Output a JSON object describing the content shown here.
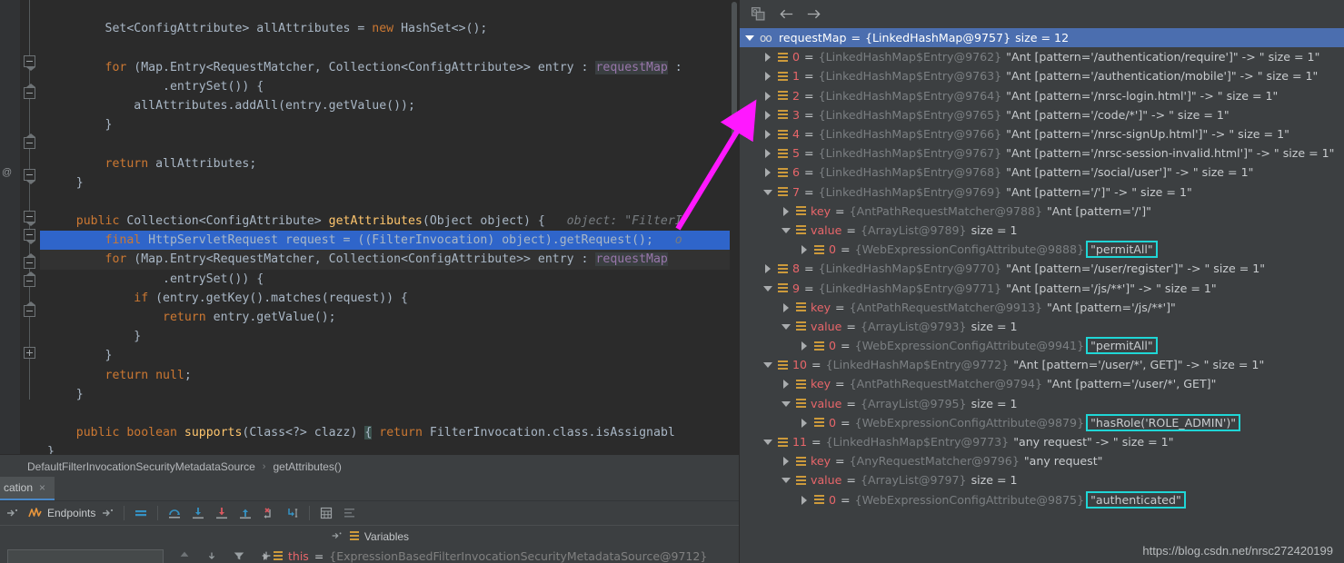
{
  "editor": {
    "lines": [
      {
        "indent": 0,
        "tokens": []
      },
      {
        "indent": 0,
        "tokens": [
          {
            "t": "        ",
            "c": "pa"
          },
          {
            "t": "Set<ConfigAttribute> allAttributes = ",
            "c": "pa"
          },
          {
            "t": "new ",
            "c": "k"
          },
          {
            "t": "HashSet<>();",
            "c": "pa"
          }
        ]
      },
      {
        "indent": 0,
        "tokens": []
      },
      {
        "indent": 0,
        "tokens": [
          {
            "t": "        ",
            "c": "pa"
          },
          {
            "t": "for ",
            "c": "k"
          },
          {
            "t": "(Map.Entry<RequestMatcher, Collection<ConfigAttribute>> entry : ",
            "c": "pa"
          },
          {
            "t": "requestMap",
            "c": "hl-field"
          },
          {
            "t": " :",
            "c": "pa"
          }
        ]
      },
      {
        "indent": 0,
        "tokens": [
          {
            "t": "                .entrySet()) {",
            "c": "pa"
          }
        ]
      },
      {
        "indent": 0,
        "tokens": [
          {
            "t": "            allAttributes.addAll(entry.getValue());",
            "c": "pa"
          }
        ]
      },
      {
        "indent": 0,
        "tokens": [
          {
            "t": "        }",
            "c": "pa"
          }
        ]
      },
      {
        "indent": 0,
        "tokens": []
      },
      {
        "indent": 0,
        "tokens": [
          {
            "t": "        ",
            "c": "pa"
          },
          {
            "t": "return ",
            "c": "k"
          },
          {
            "t": "allAttributes;",
            "c": "pa"
          }
        ]
      },
      {
        "indent": 0,
        "tokens": [
          {
            "t": "    }",
            "c": "pa"
          }
        ]
      },
      {
        "indent": 0,
        "tokens": []
      },
      {
        "indent": 0,
        "tokens": [
          {
            "t": "    ",
            "c": "pa"
          },
          {
            "t": "public ",
            "c": "k"
          },
          {
            "t": "Collection<ConfigAttribute> ",
            "c": "pa"
          },
          {
            "t": "getAttributes",
            "c": "fn"
          },
          {
            "t": "(Object object) {",
            "c": "pa"
          },
          {
            "t": "   object: ",
            "c": "hint"
          },
          {
            "t": "\"FilterI",
            "c": "hint"
          }
        ]
      },
      {
        "indent": 0,
        "selected": true,
        "tokens": [
          {
            "t": "        ",
            "c": "pa"
          },
          {
            "t": "final ",
            "c": "k"
          },
          {
            "t": "HttpServletRequest request = ((FilterInvocation) object).getRequest();",
            "c": "pa"
          },
          {
            "t": "   o",
            "c": "hint"
          }
        ]
      },
      {
        "indent": 0,
        "current": true,
        "tokens": [
          {
            "t": "        ",
            "c": "pa"
          },
          {
            "t": "for ",
            "c": "k"
          },
          {
            "t": "(Map.Entry<RequestMatcher, Collection<ConfigAttribute>> entry : ",
            "c": "pa"
          },
          {
            "t": "requestMap",
            "c": "hl-field"
          }
        ]
      },
      {
        "indent": 0,
        "tokens": [
          {
            "t": "                .entrySet()) {",
            "c": "pa"
          }
        ]
      },
      {
        "indent": 0,
        "tokens": [
          {
            "t": "            ",
            "c": "pa"
          },
          {
            "t": "if ",
            "c": "k"
          },
          {
            "t": "(entry.getKey().matches(request)) {",
            "c": "pa"
          }
        ]
      },
      {
        "indent": 0,
        "tokens": [
          {
            "t": "                ",
            "c": "pa"
          },
          {
            "t": "return ",
            "c": "k"
          },
          {
            "t": "entry.getValue();",
            "c": "pa"
          }
        ]
      },
      {
        "indent": 0,
        "tokens": [
          {
            "t": "            }",
            "c": "pa"
          }
        ]
      },
      {
        "indent": 0,
        "tokens": [
          {
            "t": "        }",
            "c": "pa"
          }
        ]
      },
      {
        "indent": 0,
        "tokens": [
          {
            "t": "        ",
            "c": "pa"
          },
          {
            "t": "return ",
            "c": "k"
          },
          {
            "t": "null",
            "c": "k"
          },
          {
            "t": ";",
            "c": "pa"
          }
        ]
      },
      {
        "indent": 0,
        "tokens": [
          {
            "t": "    }",
            "c": "pa"
          }
        ]
      },
      {
        "indent": 0,
        "tokens": []
      },
      {
        "indent": 0,
        "tokens": [
          {
            "t": "    ",
            "c": "pa"
          },
          {
            "t": "public ",
            "c": "k"
          },
          {
            "t": "boolean ",
            "c": "k"
          },
          {
            "t": "supports",
            "c": "fn"
          },
          {
            "t": "(Class<?> clazz) ",
            "c": "pa"
          },
          {
            "t": "{",
            "c": "brace-hl"
          },
          {
            "t": " ",
            "c": "pa"
          },
          {
            "t": "return ",
            "c": "k"
          },
          {
            "t": "FilterInvocation.class.isAssignabl",
            "c": "pa"
          }
        ]
      },
      {
        "indent": 0,
        "tokens": [
          {
            "t": "}",
            "c": "pa"
          }
        ]
      }
    ]
  },
  "breadcrumb": {
    "class_name": "DefaultFilterInvocationSecurityMetadataSource",
    "separator": "›",
    "method_name": "getAttributes()"
  },
  "tool_window": {
    "tab_label": "cation",
    "close_glyph": "×"
  },
  "debug_toolbar": {
    "endpoints_label": "Endpoints",
    "icons": [
      "mute-breakpoints-icon",
      "step-over-icon",
      "step-into-icon",
      "force-step-into-icon",
      "step-out-icon",
      "drop-frame-icon",
      "run-to-cursor-icon",
      "evaluate-expression-icon",
      "settings-icon"
    ]
  },
  "variables_panel": {
    "header_label": "Variables",
    "row": {
      "name": "this",
      "equals": "=",
      "type": "{ExpressionBasedFilterInvocationSecurityMetadataSource@9712}"
    }
  },
  "inspect": {
    "toolbar_icons": [
      "copy-value-icon",
      "back-arrow-icon",
      "forward-arrow-icon"
    ],
    "root": {
      "twist": "open",
      "icon": "chain-icon",
      "icon_glyph": "oo",
      "name": "requestMap",
      "equals": "=",
      "type": "{LinkedHashMap@9757}",
      "value": "size = 12",
      "selected": true
    },
    "rows": [
      {
        "depth": 1,
        "twist": "closed",
        "idx": "0",
        "equals": "=",
        "type": "{LinkedHashMap$Entry@9762}",
        "value": "\"Ant [pattern='/authentication/require']\" -> \" size = 1\""
      },
      {
        "depth": 1,
        "twist": "closed",
        "idx": "1",
        "equals": "=",
        "type": "{LinkedHashMap$Entry@9763}",
        "value": "\"Ant [pattern='/authentication/mobile']\" -> \" size = 1\""
      },
      {
        "depth": 1,
        "twist": "closed",
        "idx": "2",
        "equals": "=",
        "type": "{LinkedHashMap$Entry@9764}",
        "value": "\"Ant [pattern='/nrsc-login.html']\" -> \" size = 1\""
      },
      {
        "depth": 1,
        "twist": "closed",
        "idx": "3",
        "equals": "=",
        "type": "{LinkedHashMap$Entry@9765}",
        "value": "\"Ant [pattern='/code/*']\" -> \" size = 1\""
      },
      {
        "depth": 1,
        "twist": "closed",
        "idx": "4",
        "equals": "=",
        "type": "{LinkedHashMap$Entry@9766}",
        "value": "\"Ant [pattern='/nrsc-signUp.html']\" -> \" size = 1\""
      },
      {
        "depth": 1,
        "twist": "closed",
        "idx": "5",
        "equals": "=",
        "type": "{LinkedHashMap$Entry@9767}",
        "value": "\"Ant [pattern='/nrsc-session-invalid.html']\" -> \" size = 1\""
      },
      {
        "depth": 1,
        "twist": "closed",
        "idx": "6",
        "equals": "=",
        "type": "{LinkedHashMap$Entry@9768}",
        "value": "\"Ant [pattern='/social/user']\" -> \" size = 1\""
      },
      {
        "depth": 1,
        "twist": "open",
        "idx": "7",
        "equals": "=",
        "type": "{LinkedHashMap$Entry@9769}",
        "value": "\"Ant [pattern='/']\" -> \" size = 1\""
      },
      {
        "depth": 2,
        "twist": "closed",
        "idx": "key",
        "equals": "=",
        "type": "{AntPathRequestMatcher@9788}",
        "value": "\"Ant [pattern='/']\""
      },
      {
        "depth": 2,
        "twist": "open",
        "idx": "value",
        "equals": "=",
        "type": "{ArrayList@9789}",
        "value": "size = 1"
      },
      {
        "depth": 3,
        "twist": "closed",
        "idx": "0",
        "equals": "=",
        "type": "{WebExpressionConfigAttribute@9888}",
        "value": "\"permitAll\"",
        "boxed": true
      },
      {
        "depth": 1,
        "twist": "closed",
        "idx": "8",
        "equals": "=",
        "type": "{LinkedHashMap$Entry@9770}",
        "value": "\"Ant [pattern='/user/register']\" -> \" size = 1\""
      },
      {
        "depth": 1,
        "twist": "open",
        "idx": "9",
        "equals": "=",
        "type": "{LinkedHashMap$Entry@9771}",
        "value": "\"Ant [pattern='/js/**']\" -> \" size = 1\""
      },
      {
        "depth": 2,
        "twist": "closed",
        "idx": "key",
        "equals": "=",
        "type": "{AntPathRequestMatcher@9913}",
        "value": "\"Ant [pattern='/js/**']\""
      },
      {
        "depth": 2,
        "twist": "open",
        "idx": "value",
        "equals": "=",
        "type": "{ArrayList@9793}",
        "value": "size = 1"
      },
      {
        "depth": 3,
        "twist": "closed",
        "idx": "0",
        "equals": "=",
        "type": "{WebExpressionConfigAttribute@9941}",
        "value": "\"permitAll\"",
        "boxed": true
      },
      {
        "depth": 1,
        "twist": "open",
        "idx": "10",
        "equals": "=",
        "type": "{LinkedHashMap$Entry@9772}",
        "value": "\"Ant [pattern='/user/*', GET]\" -> \" size = 1\""
      },
      {
        "depth": 2,
        "twist": "closed",
        "idx": "key",
        "equals": "=",
        "type": "{AntPathRequestMatcher@9794}",
        "value": "\"Ant [pattern='/user/*', GET]\""
      },
      {
        "depth": 2,
        "twist": "open",
        "idx": "value",
        "equals": "=",
        "type": "{ArrayList@9795}",
        "value": "size = 1"
      },
      {
        "depth": 3,
        "twist": "closed",
        "idx": "0",
        "equals": "=",
        "type": "{WebExpressionConfigAttribute@9879}",
        "value": "\"hasRole('ROLE_ADMIN')\"",
        "boxed": true
      },
      {
        "depth": 1,
        "twist": "open",
        "idx": "11",
        "equals": "=",
        "type": "{LinkedHashMap$Entry@9773}",
        "value": "\"any request\" -> \" size = 1\""
      },
      {
        "depth": 2,
        "twist": "closed",
        "idx": "key",
        "equals": "=",
        "type": "{AnyRequestMatcher@9796}",
        "value": "\"any request\""
      },
      {
        "depth": 2,
        "twist": "open",
        "idx": "value",
        "equals": "=",
        "type": "{ArrayList@9797}",
        "value": "size = 1"
      },
      {
        "depth": 3,
        "twist": "closed",
        "idx": "0",
        "equals": "=",
        "type": "{WebExpressionConfigAttribute@9875}",
        "value": "\"authenticated\"",
        "boxed": true
      }
    ]
  },
  "watermark": {
    "text": "https://blog.csdn.net/nrsc272420199"
  },
  "colors": {
    "editor_bg": "#2b2b2b",
    "panel_bg": "#3c3f41",
    "selection_blue": "#2f65ca",
    "tree_selection": "#4b6eaf",
    "highlight_box": "#1fd6d6",
    "annotation_arrow": "#ff18ff",
    "keyword_orange": "#cc7832",
    "method_yellow": "#ffc66d",
    "name_red": "#e8666a",
    "type_gray": "#7b7f82"
  }
}
